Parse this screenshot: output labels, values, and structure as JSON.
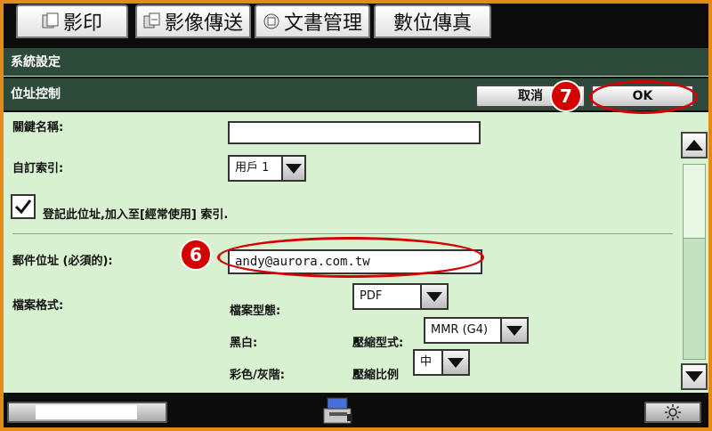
{
  "tabs": [
    {
      "label": "影印",
      "icon": "copy-icon"
    },
    {
      "label": "影像傳送",
      "icon": "image-send-icon"
    },
    {
      "label": "文書管理",
      "icon": "document-filing-icon"
    },
    {
      "label": "數位傳真",
      "icon": ""
    }
  ],
  "header": {
    "section_title": "系統設定",
    "page_title": "位址控制",
    "cancel_label": "取消",
    "ok_label": "OK"
  },
  "form": {
    "name_label": "關鍵名稱:",
    "name_value": "",
    "custom_index_label": "自訂索引:",
    "custom_index_value": "用戶 1",
    "register_checkbox_label": "登記此位址,加入至[經常使用] 索引.",
    "register_checked": true,
    "email_label": "郵件位址 (必須的):",
    "email_value": "andy@aurora.com.tw",
    "file_format_label": "檔案格式:",
    "file_type_label": "檔案型態:",
    "file_type_value": "PDF",
    "bw_label": "黑白:",
    "compression_mode_label": "壓縮型式:",
    "compression_mode_value": "MMR (G4)",
    "color_gray_label": "彩色/灰階:",
    "compression_ratio_label": "壓縮比例",
    "compression_ratio_value": "中"
  },
  "markers": {
    "step_ok": "7",
    "step_email": "6"
  },
  "colors": {
    "frame": "#e48a17",
    "header_bar": "#2d4a3b",
    "content_bg": "#d8f2d1",
    "marker_red": "#d50000"
  }
}
